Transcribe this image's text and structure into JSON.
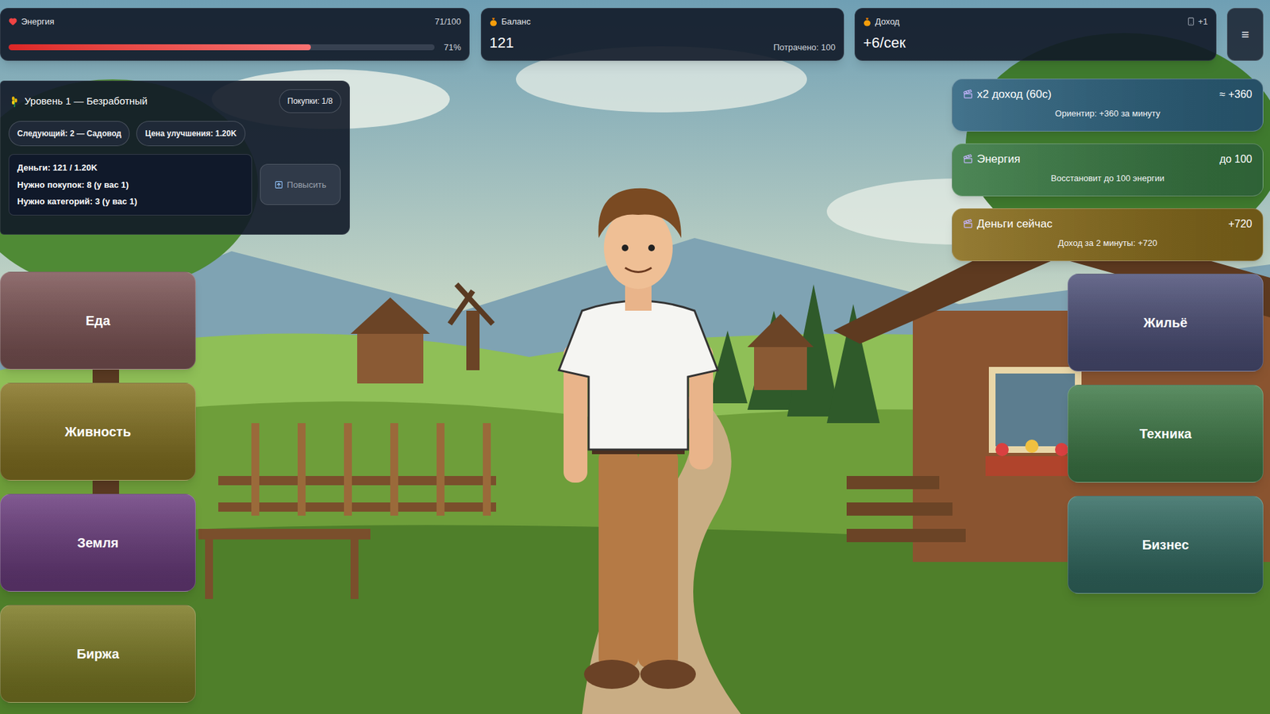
{
  "energy": {
    "label": "Энергия",
    "reading": "71/100",
    "level": 0.71,
    "percent": "71%"
  },
  "balance": {
    "label": "Баланс",
    "value": "121",
    "spent": "Потрачено: 100"
  },
  "income": {
    "label": "Доход",
    "value": "+6/сек",
    "bonus": "+1"
  },
  "menu_button": "≡",
  "level_panel": {
    "title": "Уровень 1 — Безработный",
    "purchases": "Покупки: 1/8",
    "next": "Следующий: 2 — Садовод",
    "price": "Цена улучшения: 1.20K",
    "requirements": [
      "Деньги: 121 / 1.20K",
      "Нужно покупок: 8 (у вас 1)",
      "Нужно категорий: 3 (у вас 1)"
    ],
    "upgrade_button": {
      "label": "Повысить",
      "disabled": true
    }
  },
  "boosts": [
    {
      "title": "x2 доход (60с)",
      "value": "≈ +360",
      "hint": "Ориентир: +360 за минуту",
      "color": "#2f6480"
    },
    {
      "title": "Энергия",
      "value": "до 100",
      "hint": "Восстановит до 100 энергии",
      "color": "#3a7a44"
    },
    {
      "title": "Деньги сейчас",
      "value": "+720",
      "hint": "Доход за 2 минуты: +720",
      "color": "#8a6e1e"
    }
  ],
  "categories_left": [
    {
      "label": "Еда",
      "color": "#7d5556"
    },
    {
      "label": "Живность",
      "color": "#857322"
    },
    {
      "label": "Земля",
      "color": "#6b3d7e"
    },
    {
      "label": "Биржа",
      "color": "#7c7a24"
    }
  ],
  "categories_right": [
    {
      "label": "Жильё",
      "color": "#4d5078"
    },
    {
      "label": "Техника",
      "color": "#3f7a48"
    },
    {
      "label": "Бизнес",
      "color": "#336b62"
    }
  ]
}
